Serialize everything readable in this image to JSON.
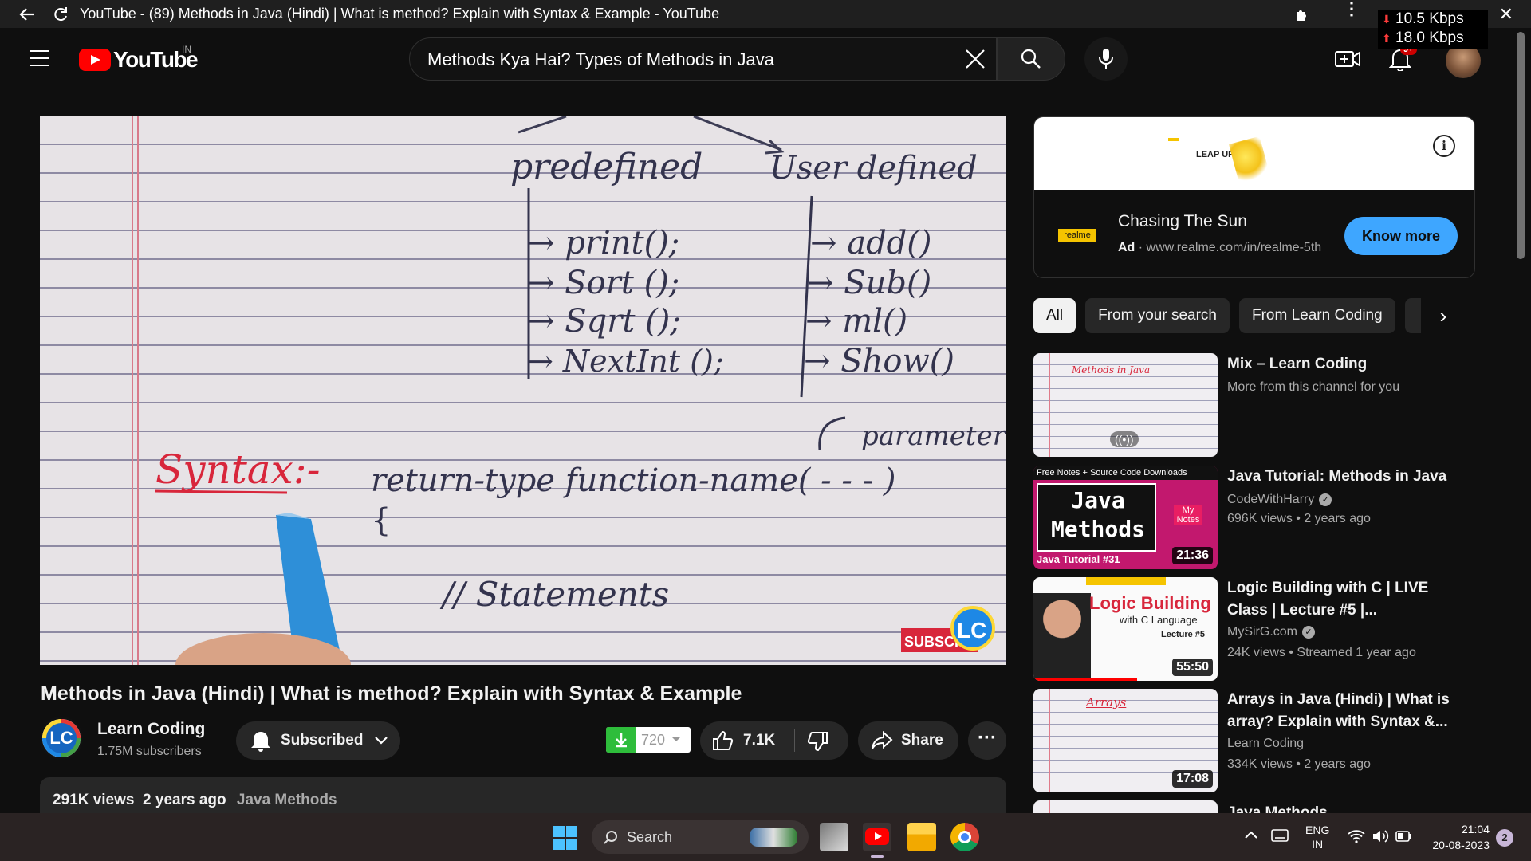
{
  "browser": {
    "title": "YouTube - (89) Methods in Java (Hindi) | What is method? Explain with Syntax & Example - YouTube",
    "net_down": "10.5 Kbps",
    "net_up": "18.0 Kbps"
  },
  "masthead": {
    "logo_text": "YouTube",
    "country_code": "IN",
    "search_query": "Methods Kya Hai? Types of Methods in Java",
    "notification_badge": "9+"
  },
  "player": {
    "notes": {
      "predefined": "predefined",
      "user_defined": "User defined",
      "pre_items": [
        "→ print();",
        "→ Sort ();",
        "→ Sqrt ();",
        "→ NextInt ();"
      ],
      "user_items": [
        "→ add()",
        "→ Sub()",
        "→ ml()",
        "→ Show()"
      ],
      "syntax": "Syntax:-",
      "parameters": "parameters",
      "signature": "return-type  function-name( - - - )",
      "brace": "{",
      "statements": "// Statements"
    },
    "watermark": "SUBSCR",
    "logo": "LC"
  },
  "video": {
    "title": "Methods in Java (Hindi) | What is method? Explain with Syntax & Example",
    "channel": "Learn Coding",
    "channel_logo": "LC",
    "subscribers": "1.75M subscribers",
    "subscribe_label": "Subscribed",
    "download_count": "720",
    "likes": "7.1K",
    "share_label": "Share",
    "views": "291K views",
    "age": "2 years ago",
    "hashtag": "Java Methods"
  },
  "ad": {
    "banner_text": "LEAP UP",
    "title": "Chasing The Sun",
    "brand": "realme",
    "ad_label": "Ad",
    "url": "www.realme.com/in/realme-5th",
    "cta": "Know more"
  },
  "chips": [
    "All",
    "From your search",
    "From Learn Coding"
  ],
  "recommendations": [
    {
      "title": "Mix – Learn Coding",
      "channel": "More from this channel for you",
      "meta": "",
      "duration": "",
      "thumb_text": "Methods in Java"
    },
    {
      "title": "Java Tutorial: Methods in Java",
      "channel": "CodeWithHarry",
      "meta": "696K views  • 2 years ago",
      "duration": "21:36",
      "thumb_top": "Free Notes + Source Code Downloads",
      "thumb_main": "Java Methods",
      "thumb_badge": "My Notes",
      "thumb_bottom": "Java Tutorial #31"
    },
    {
      "title": "Logic Building with C | LIVE Class | Lecture #5 |...",
      "channel": "MySirG.com",
      "meta": "24K views  • Streamed 1 year ago",
      "duration": "55:50",
      "thumb_main": "Logic Building",
      "thumb_sub": "with C Language",
      "thumb_lecture": "Lecture #5"
    },
    {
      "title": "Arrays in Java (Hindi) | What is array? Explain with Syntax &...",
      "channel": "Learn Coding",
      "meta": "334K views  • 2 years ago",
      "duration": "17:08",
      "thumb_text": "Arrays"
    },
    {
      "title": "Java Methods",
      "channel": "",
      "meta": "",
      "duration": ""
    }
  ],
  "taskbar": {
    "search": "Search",
    "lang": "ENG",
    "region": "IN",
    "time": "21:04",
    "date": "20-08-2023",
    "notif_count": "2"
  }
}
